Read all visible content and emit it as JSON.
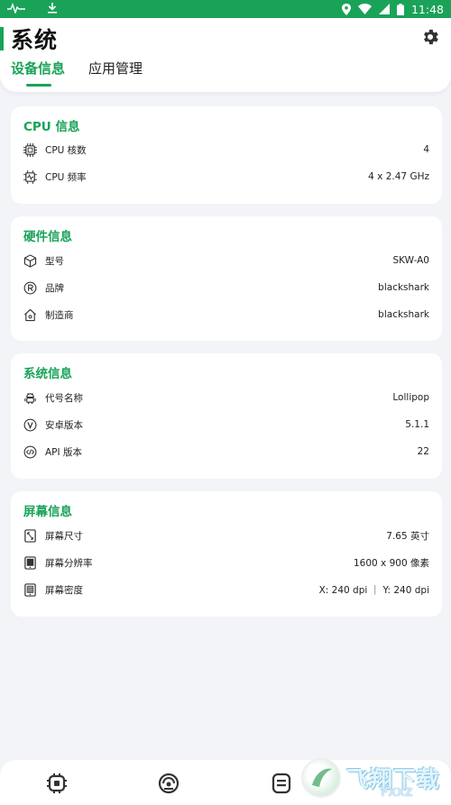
{
  "status_bar": {
    "time": "11:48"
  },
  "header": {
    "title": "系统",
    "tabs": [
      {
        "label": "设备信息",
        "active": true
      },
      {
        "label": "应用管理",
        "active": false
      }
    ]
  },
  "cards": {
    "cpu": {
      "title": "CPU 信息",
      "rows": [
        {
          "icon": "chip-icon",
          "label": "CPU 核数",
          "value": "4"
        },
        {
          "icon": "frequency-icon",
          "label": "CPU 频率",
          "value": "4 x 2.47 GHz"
        }
      ]
    },
    "hardware": {
      "title": "硬件信息",
      "rows": [
        {
          "icon": "cube-icon",
          "label": "型号",
          "value": "SKW-A0"
        },
        {
          "icon": "registered-icon",
          "label": "品牌",
          "value": "blackshark"
        },
        {
          "icon": "home-icon",
          "label": "制造商",
          "value": "blackshark"
        }
      ]
    },
    "system": {
      "title": "系统信息",
      "rows": [
        {
          "icon": "android-icon",
          "label": "代号名称",
          "value": "Lollipop"
        },
        {
          "icon": "version-icon",
          "label": "安卓版本",
          "value": "5.1.1"
        },
        {
          "icon": "code-icon",
          "label": "API 版本",
          "value": "22"
        }
      ]
    },
    "screen": {
      "title": "屏幕信息",
      "rows": [
        {
          "icon": "screen-size-icon",
          "label": "屏幕尺寸",
          "value": "7.65 英寸"
        },
        {
          "icon": "tablet-icon",
          "label": "屏幕分辨率",
          "value": "1600 x 900 像素"
        },
        {
          "icon": "density-icon",
          "label": "屏幕密度",
          "value": "X: 240 dpi ｜ Y: 240 dpi"
        }
      ]
    }
  },
  "watermark": {
    "text": "飞翔下载",
    "sub": "FXXZ"
  },
  "colors": {
    "accent": "#1aa358",
    "background": "#f3f4f8"
  }
}
